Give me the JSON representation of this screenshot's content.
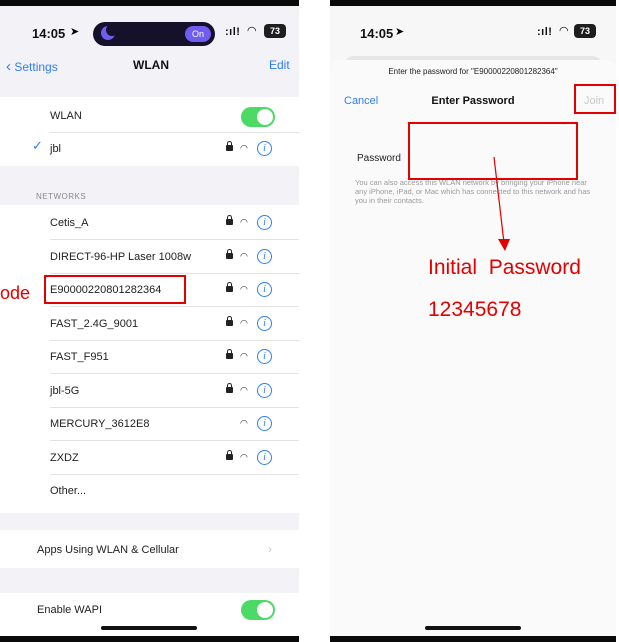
{
  "left": {
    "status_time": "14:05",
    "focus_badge": "On",
    "battery": "73",
    "signal": ":ıl!",
    "nav": {
      "back": "Settings",
      "title": "WLAN",
      "edit": "Edit"
    },
    "wlan_label": "WLAN",
    "wlan_on": true,
    "connected_network": "jbl",
    "section_networks": "NETWORKS",
    "networks": [
      {
        "name": "Cetis_A",
        "lock": true
      },
      {
        "name": "DIRECT-96-HP Laser 1008w",
        "lock": true
      },
      {
        "name": "E90000220801282364",
        "lock": true
      },
      {
        "name": "FAST_2.4G_9001",
        "lock": true
      },
      {
        "name": "FAST_F951",
        "lock": true
      },
      {
        "name": "jbl-5G",
        "lock": true
      },
      {
        "name": "MERCURY_3612E8",
        "lock": false
      },
      {
        "name": "ZXDZ",
        "lock": true
      }
    ],
    "other": "Other...",
    "apps_row": "Apps Using WLAN & Cellular",
    "wapi_label": "Enable WAPI",
    "wapi_on": true,
    "annotation_fragment": "ode"
  },
  "right": {
    "status_time": "14:05",
    "battery": "73",
    "signal": ":ıl!",
    "prompt": "Enter the password for \"E90000220801282364\"",
    "cancel": "Cancel",
    "title": "Enter Password",
    "join": "Join",
    "password_label": "Password",
    "password_value": "",
    "hint": "You can also access this WLAN network by bringing your iPhone near any iPhone, iPad, or Mac which has connected to this network and has you in their contacts.",
    "annotation_line1": "Initial  Password",
    "annotation_line2": "12345678"
  },
  "colors": {
    "accent": "#2f7df6",
    "toggle": "#4cd964",
    "annotation": "#e30000"
  },
  "icons": {
    "lock": "lock-icon",
    "wifi": "wifi-icon",
    "info": "info-icon",
    "check": "checkmark-icon",
    "back": "chevron-left-icon"
  }
}
